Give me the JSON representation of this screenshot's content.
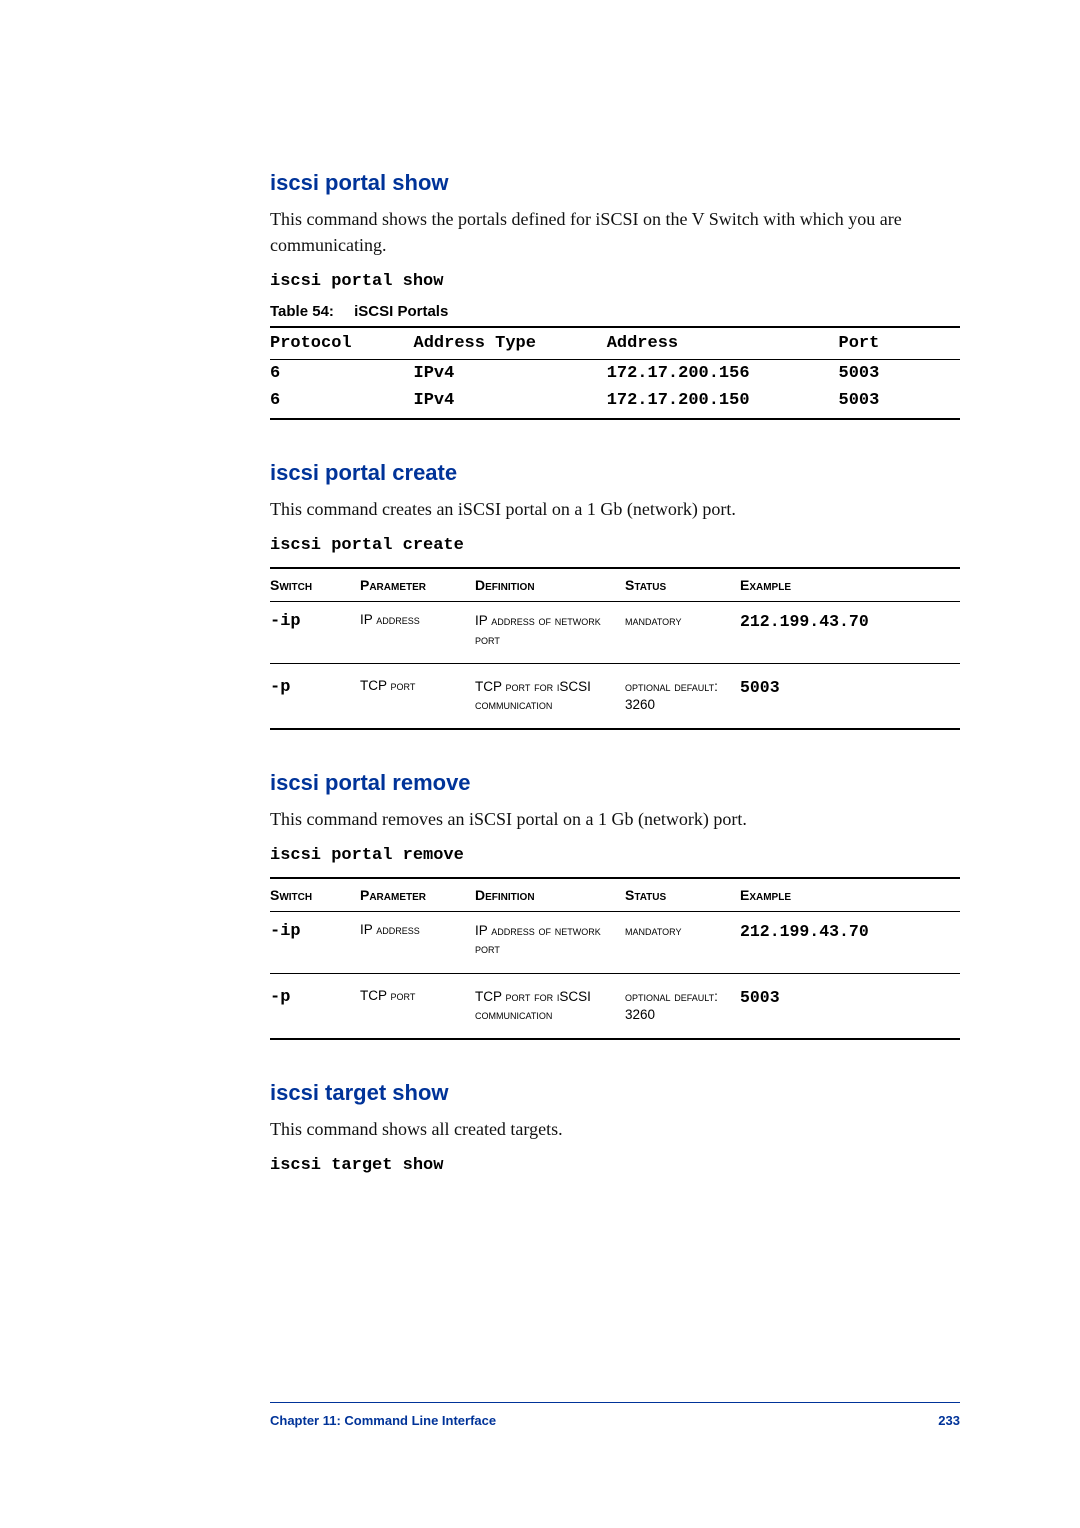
{
  "sections": {
    "portal_show": {
      "heading": "iscsi portal show",
      "desc": "This command shows the portals defined for iSCSI on the V Switch with which you are communicating.",
      "cmd": "iscsi portal show"
    },
    "portal_create": {
      "heading": "iscsi portal create",
      "desc": "This command creates an iSCSI portal on a 1 Gb (network) port.",
      "cmd": "iscsi portal create"
    },
    "portal_remove": {
      "heading": "iscsi portal remove",
      "desc": "This command removes an iSCSI portal on a 1 Gb (network) port.",
      "cmd": "iscsi portal remove"
    },
    "target_show": {
      "heading": "iscsi target show",
      "desc": "This command shows all created targets.",
      "cmd": "iscsi target show"
    }
  },
  "portals_table": {
    "caption_num": "Table  54:",
    "caption_name": "iSCSI Portals",
    "headers": {
      "protocol": "Protocol",
      "addrtype": "Address Type",
      "address": "Address",
      "port": "Port"
    },
    "rows": [
      {
        "protocol": "6",
        "addrtype": "IPv4",
        "address": "172.17.200.156",
        "port": "5003"
      },
      {
        "protocol": "6",
        "addrtype": "IPv4",
        "address": "172.17.200.150",
        "port": "5003"
      }
    ]
  },
  "params_headers": {
    "switch": "Switch",
    "parameter": "Parameter",
    "definition": "Definition",
    "status": "Status",
    "example": "Example"
  },
  "create_params": [
    {
      "switch": "-ip",
      "parameter": "IP address",
      "definition": "IP address of network port",
      "status": "mandatory",
      "example": "212.199.43.70"
    },
    {
      "switch": "-p",
      "parameter": "TCP port",
      "definition": "TCP port for iSCSI communication",
      "status": "optional default: 3260",
      "example": "5003"
    }
  ],
  "remove_params": [
    {
      "switch": "-ip",
      "parameter": "IP address",
      "definition": "IP address of network port",
      "status": "mandatory",
      "example": "212.199.43.70"
    },
    {
      "switch": "-p",
      "parameter": "TCP port",
      "definition": "TCP port for iSCSI communication",
      "status": "optional default: 3260",
      "example": "5003"
    }
  ],
  "footer": {
    "chapter": "Chapter 11:  Command Line Interface",
    "page": "233"
  }
}
